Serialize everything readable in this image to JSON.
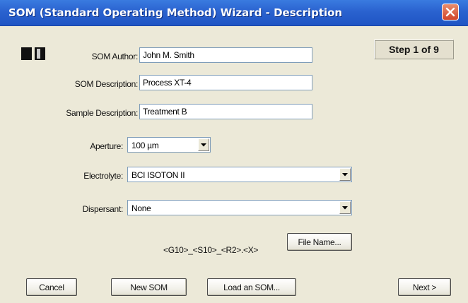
{
  "window": {
    "title": "SOM (Standard Operating Method) Wizard - Description"
  },
  "step": "Step 1 of 9",
  "form": {
    "author_label": "SOM Author:",
    "author_value": "John M. Smith",
    "description_label": "SOM Description:",
    "description_value": "Process XT-4",
    "sample_label": "Sample Description:",
    "sample_value": "Treatment B",
    "aperture_label": "Aperture:",
    "aperture_value": "100 µm",
    "electrolyte_label": "Electrolyte:",
    "electrolyte_value": "BCI ISOTON II",
    "dispersant_label": "Dispersant:",
    "dispersant_value": "None"
  },
  "file_name": {
    "pattern": "<G10>_<S10>_<R2>.<X>",
    "button_label": "File Name..."
  },
  "buttons": {
    "cancel": "Cancel",
    "new_som": "New SOM",
    "load_som": "Load an SOM...",
    "next": "Next >"
  },
  "icons": {
    "close": "close-icon",
    "app": "instrument-icon",
    "dropdown": "chevron-down-icon"
  },
  "colors": {
    "titlebar": "#2a62cf",
    "dialog_bg": "#ece9d8",
    "close_button": "#d2452a"
  }
}
